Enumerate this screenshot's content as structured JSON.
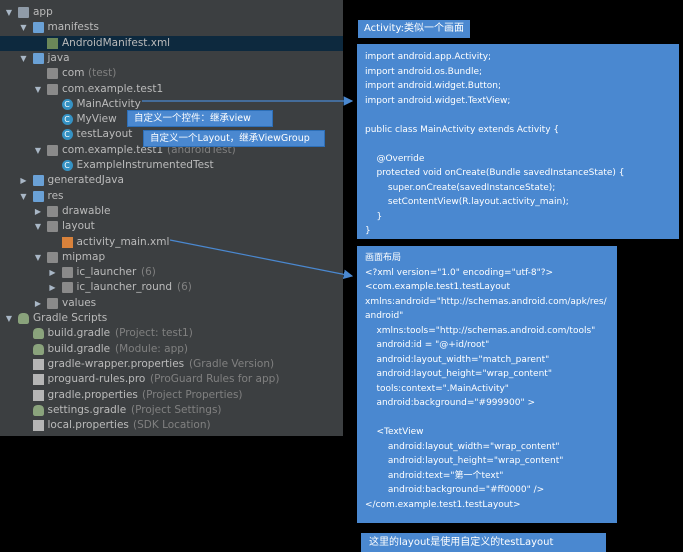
{
  "tree": [
    {
      "label": "app",
      "indent": 0,
      "arrow": "down",
      "icon": "folder-module",
      "iconClass": "folder"
    },
    {
      "label": "manifests",
      "indent": 1,
      "arrow": "down",
      "icon": "folder",
      "iconClass": "folder blue"
    },
    {
      "label": "AndroidManifest.xml",
      "indent": 2,
      "arrow": "",
      "icon": "manifest-icon",
      "iconClass": "mf",
      "selected": true
    },
    {
      "label": "java",
      "indent": 1,
      "arrow": "down",
      "icon": "folder",
      "iconClass": "folder blue"
    },
    {
      "label": "com",
      "hint": "(test)",
      "indent": 2,
      "arrow": "",
      "icon": "package-icon",
      "iconClass": "folder gray"
    },
    {
      "label": "com.example.test1",
      "indent": 2,
      "arrow": "down",
      "icon": "package-icon",
      "iconClass": "folder gray"
    },
    {
      "label": "MainActivity",
      "indent": 3,
      "arrow": "",
      "icon": "class-icon",
      "iconClass": "cls",
      "glyph": "C"
    },
    {
      "label": "MyView",
      "indent": 3,
      "arrow": "",
      "icon": "class-icon",
      "iconClass": "cls",
      "glyph": "C"
    },
    {
      "label": "testLayout",
      "indent": 3,
      "arrow": "",
      "icon": "class-icon",
      "iconClass": "cls",
      "glyph": "C"
    },
    {
      "label": "com.example.test1",
      "hint": "(androidTest)",
      "indent": 2,
      "arrow": "down",
      "icon": "package-icon",
      "iconClass": "folder gray"
    },
    {
      "label": "ExampleInstrumentedTest",
      "indent": 3,
      "arrow": "",
      "icon": "class-icon",
      "iconClass": "cls",
      "glyph": "C"
    },
    {
      "label": "generatedJava",
      "indent": 1,
      "arrow": "right",
      "icon": "folder",
      "iconClass": "folder blue"
    },
    {
      "label": "res",
      "indent": 1,
      "arrow": "down",
      "icon": "folder",
      "iconClass": "folder blue"
    },
    {
      "label": "drawable",
      "indent": 2,
      "arrow": "right",
      "icon": "folder",
      "iconClass": "folder gray"
    },
    {
      "label": "layout",
      "indent": 2,
      "arrow": "down",
      "icon": "folder",
      "iconClass": "folder gray"
    },
    {
      "label": "activity_main.xml",
      "indent": 3,
      "arrow": "",
      "icon": "xml-icon",
      "iconClass": "xmlico"
    },
    {
      "label": "mipmap",
      "indent": 2,
      "arrow": "down",
      "icon": "folder",
      "iconClass": "folder gray"
    },
    {
      "label": "ic_launcher",
      "hint": "(6)",
      "indent": 3,
      "arrow": "right",
      "icon": "folder",
      "iconClass": "folder gray"
    },
    {
      "label": "ic_launcher_round",
      "hint": "(6)",
      "indent": 3,
      "arrow": "right",
      "icon": "folder",
      "iconClass": "folder gray"
    },
    {
      "label": "values",
      "indent": 2,
      "arrow": "right",
      "icon": "folder",
      "iconClass": "folder gray"
    },
    {
      "label": "Gradle Scripts",
      "indent": 0,
      "arrow": "down",
      "icon": "gradle-icon",
      "iconClass": "gradle"
    },
    {
      "label": "build.gradle",
      "hint": "(Project: test1)",
      "indent": 1,
      "arrow": "",
      "icon": "gradle-icon",
      "iconClass": "gradle"
    },
    {
      "label": "build.gradle",
      "hint": "(Module: app)",
      "indent": 1,
      "arrow": "",
      "icon": "gradle-icon",
      "iconClass": "gradle"
    },
    {
      "label": "gradle-wrapper.properties",
      "hint": "(Gradle Version)",
      "indent": 1,
      "arrow": "",
      "icon": "properties-icon",
      "iconClass": "prop"
    },
    {
      "label": "proguard-rules.pro",
      "hint": "(ProGuard Rules for app)",
      "indent": 1,
      "arrow": "",
      "icon": "properties-icon",
      "iconClass": "prop"
    },
    {
      "label": "gradle.properties",
      "hint": "(Project Properties)",
      "indent": 1,
      "arrow": "",
      "icon": "properties-icon",
      "iconClass": "prop"
    },
    {
      "label": "settings.gradle",
      "hint": "(Project Settings)",
      "indent": 1,
      "arrow": "",
      "icon": "gradle-icon",
      "iconClass": "gradle"
    },
    {
      "label": "local.properties",
      "hint": "(SDK Location)",
      "indent": 1,
      "arrow": "",
      "icon": "properties-icon",
      "iconClass": "prop"
    }
  ],
  "activity_title": "Activity:类似一个画面",
  "activity_code": "import android.app.Activity;\nimport android.os.Bundle;\nimport android.widget.Button;\nimport android.widget.TextView;\n\npublic class MainActivity extends Activity {\n\n    @Override\n    protected void onCreate(Bundle savedInstanceState) {\n        super.onCreate(savedInstanceState);\n        setContentView(R.layout.activity_main);\n    }\n}",
  "layout_code": "画面布局\n<?xml version=\"1.0\" encoding=\"utf-8\"?>\n<com.example.test1.testLayout\nxmlns:android=\"http://schemas.android.com/apk/res/\nandroid\"\n    xmlns:tools=\"http://schemas.android.com/tools\"\n    android:id = \"@+id/root\"\n    android:layout_width=\"match_parent\"\n    android:layout_height=\"wrap_content\"\n    tools:context=\".MainActivity\"\n    android:background=\"#999900\" >\n\n    <TextView\n        android:layout_width=\"wrap_content\"\n        android:layout_height=\"wrap_content\"\n        android:text=\"第一个text\"\n        android:background=\"#ff0000\" />\n</com.example.test1.testLayout>",
  "callout_view": "自定义一个控件：继承view",
  "callout_layout": "自定义一个Layout，继承ViewGroup",
  "bottom_note": "这里的layout是使用自定义的testLayout"
}
